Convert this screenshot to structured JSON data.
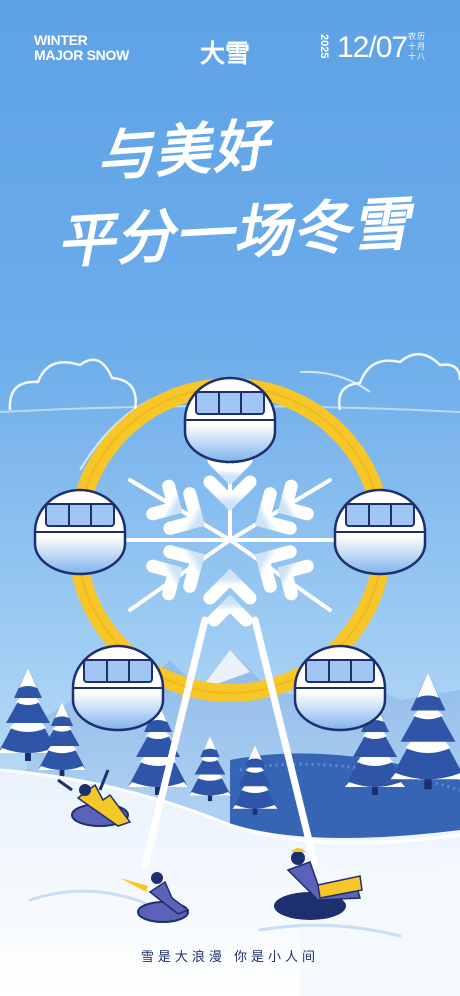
{
  "header": {
    "en_line1": "WINTER",
    "en_line2": "MAJOR SNOW",
    "solar_term": "大雪",
    "year": "2025",
    "date": "12/07",
    "lunar_chars": [
      "农",
      "十",
      "十",
      "历",
      "月",
      "八"
    ]
  },
  "slogan": {
    "line1": "与美好",
    "line2": "平分一场冬雪"
  },
  "footer": {
    "text": "雪是大浪漫  你是小人间"
  },
  "colors": {
    "sky": "#5ea2e6",
    "wheel_rim": "#f7c629",
    "navy": "#1d2f6e",
    "snow": "#ffffff"
  },
  "icons": [
    "snowflake-icon",
    "ferris-wheel",
    "cloud",
    "pine-tree",
    "snow-tube"
  ]
}
